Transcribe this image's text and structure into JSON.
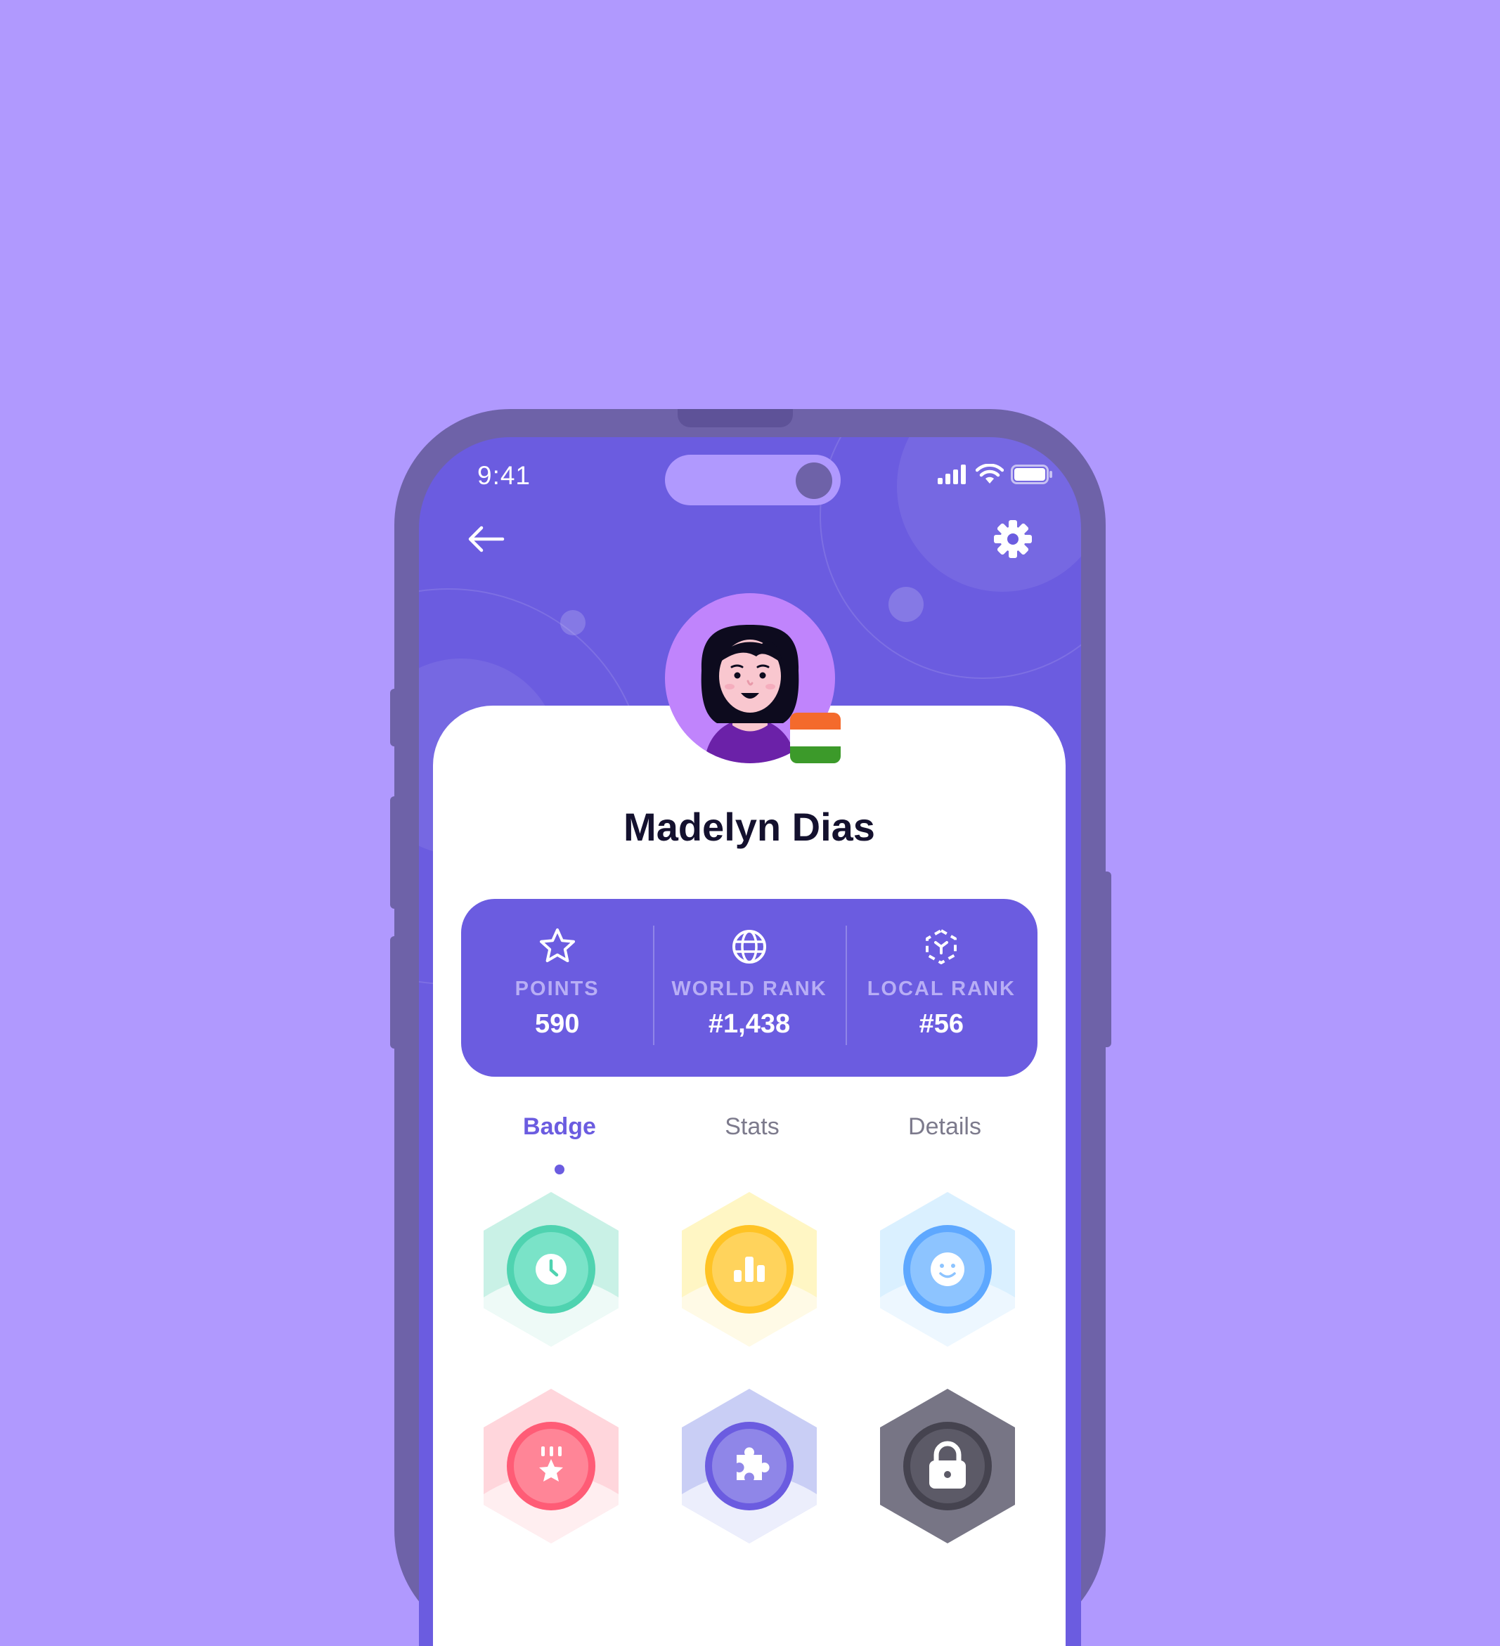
{
  "status_bar": {
    "time": "9:41"
  },
  "header": {
    "back_icon": "arrow-left-icon",
    "settings_icon": "gear-icon"
  },
  "profile": {
    "name": "Madelyn Dias",
    "flag": "india-flag",
    "colors": {
      "avatar_bg": "#C084FC",
      "primary": "#6B5CE0"
    }
  },
  "stats": [
    {
      "icon": "star-icon",
      "label": "POINTS",
      "value": "590"
    },
    {
      "icon": "globe-icon",
      "label": "WORLD RANK",
      "value": "#1,438"
    },
    {
      "icon": "local-rank-icon",
      "label": "LOCAL RANK",
      "value": "#56"
    }
  ],
  "tabs": [
    {
      "label": "Badge",
      "active": true
    },
    {
      "label": "Stats",
      "active": false
    },
    {
      "label": "Details",
      "active": false
    }
  ],
  "badges": [
    {
      "icon": "clock-icon",
      "color": "#79E1C7",
      "locked": false
    },
    {
      "icon": "bar-chart-icon",
      "color": "#FFCD3C",
      "locked": false
    },
    {
      "icon": "smile-icon",
      "color": "#86BEFF",
      "locked": false
    },
    {
      "icon": "medal-icon",
      "color": "#FF7E92",
      "locked": false
    },
    {
      "icon": "puzzle-icon",
      "color": "#8C82E6",
      "locked": false
    },
    {
      "icon": "lock-icon",
      "color": "#45434F",
      "locked": true
    }
  ]
}
